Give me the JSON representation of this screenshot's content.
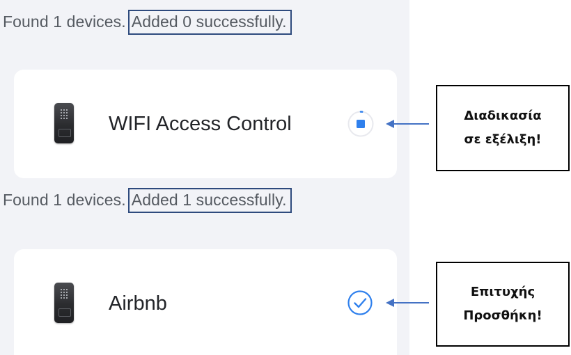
{
  "status_in_progress": {
    "prefix": "Found 1 devices.",
    "highlight": "Added 0 successfully."
  },
  "device_in_progress": {
    "name": "WIFI Access Control",
    "state_icon": "stop-progress-icon"
  },
  "callout_in_progress": {
    "line1": "Διαδικασία",
    "line2": "σε εξέλιξη!"
  },
  "status_success": {
    "prefix": "Found 1 devices.",
    "highlight": "Added 1 successfully."
  },
  "device_success": {
    "name": "Airbnb",
    "state_icon": "check-circle-icon"
  },
  "callout_success": {
    "line1": "Επιτυχής",
    "line2": "Προσθήκη!"
  },
  "colors": {
    "accent_blue": "#2f80ed",
    "highlight_border": "#2e4a7d",
    "arrow": "#4472c4",
    "panel_bg": "#f2f3f7"
  }
}
